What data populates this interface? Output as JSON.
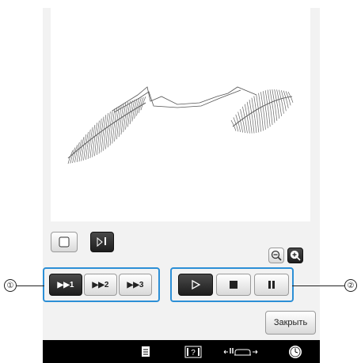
{
  "callouts": {
    "left": "①",
    "right": "②"
  },
  "speed_buttons": [
    {
      "icon": "fast-forward-icon",
      "label": "1"
    },
    {
      "icon": "fast-forward-icon",
      "label": "2"
    },
    {
      "icon": "fast-forward-icon",
      "label": "3"
    }
  ],
  "playback_buttons": [
    {
      "icon": "play-icon"
    },
    {
      "icon": "stop-icon"
    },
    {
      "icon": "pause-icon"
    }
  ],
  "close_button_label": "Закрыть",
  "colors": {
    "group_border": "#2c8fd6",
    "taskbar": "#000000"
  },
  "taskbar_icons": [
    "document-icon",
    "help-icon",
    "presser-foot-icon",
    "clock-icon"
  ]
}
